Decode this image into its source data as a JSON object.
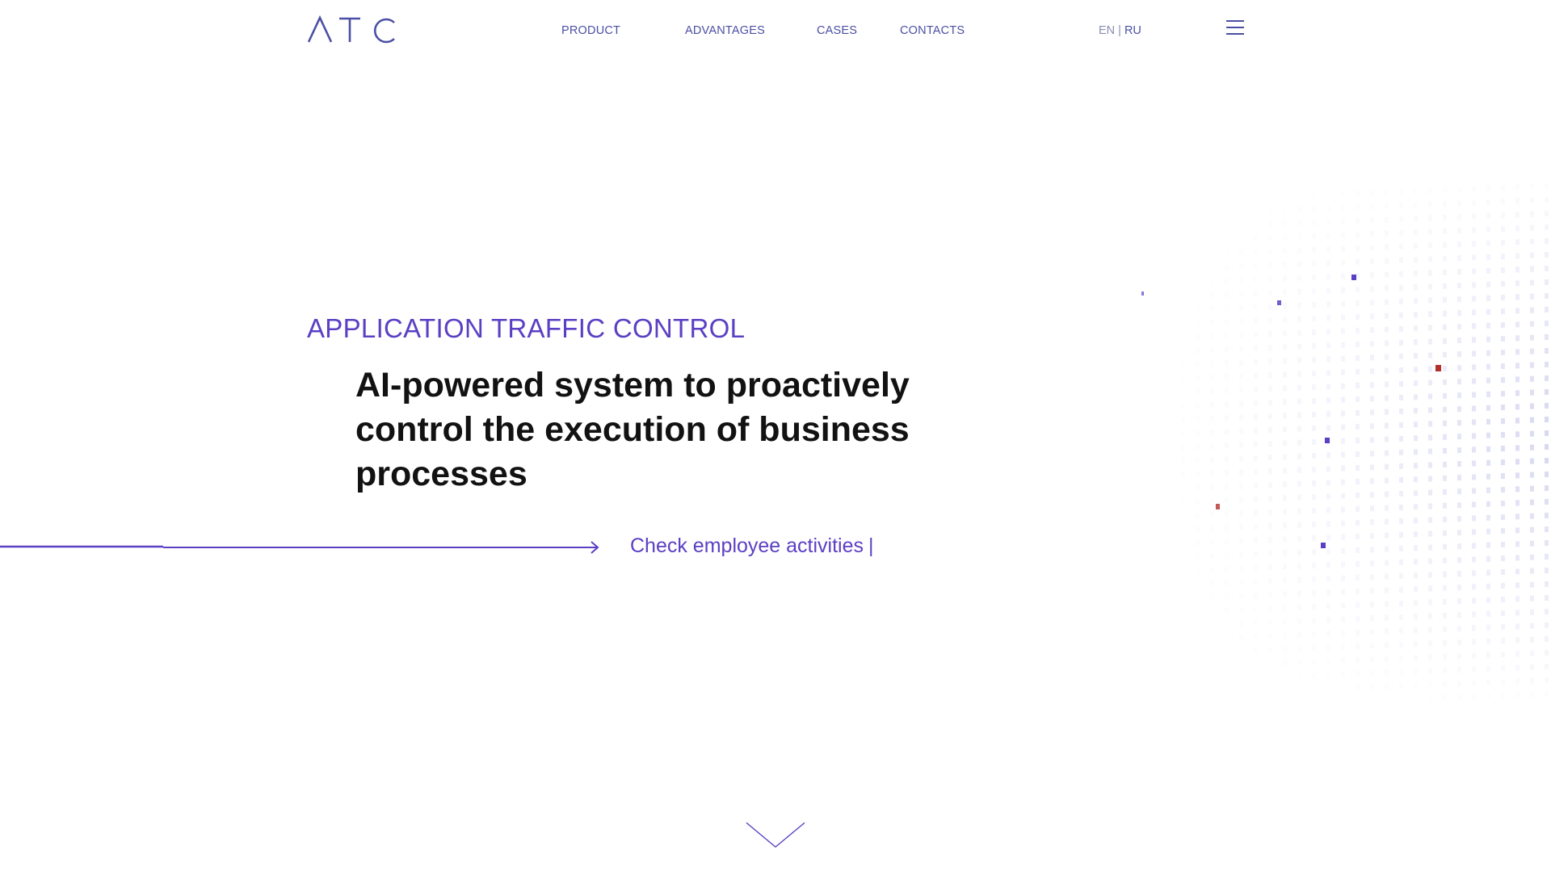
{
  "header": {
    "logo_text": "ATC",
    "nav": {
      "product": "PRODUCT",
      "advantages": "ADVANTAGES",
      "cases": "CASES",
      "contacts": "CONTACTS"
    },
    "lang": {
      "en": "EN",
      "separator": "|",
      "ru": "RU"
    },
    "menu_icon": "hamburger-menu-icon"
  },
  "hero": {
    "eyebrow": "APPLICATION TRAFFIC CONTROL",
    "headline": "AI-powered system to proactively control the execution of business processes",
    "typed_text": "Check employee activities",
    "typed_cursor": "|"
  },
  "colors": {
    "accent": "#5b3fc4",
    "nav": "#4b4fa3",
    "headline": "#121212",
    "dot": "#d4d6ef",
    "accent_red": "#b3302a",
    "background": "#ffffff"
  },
  "icons": {
    "arrow": "right-arrow-icon",
    "scroll": "chevron-down-icon"
  }
}
